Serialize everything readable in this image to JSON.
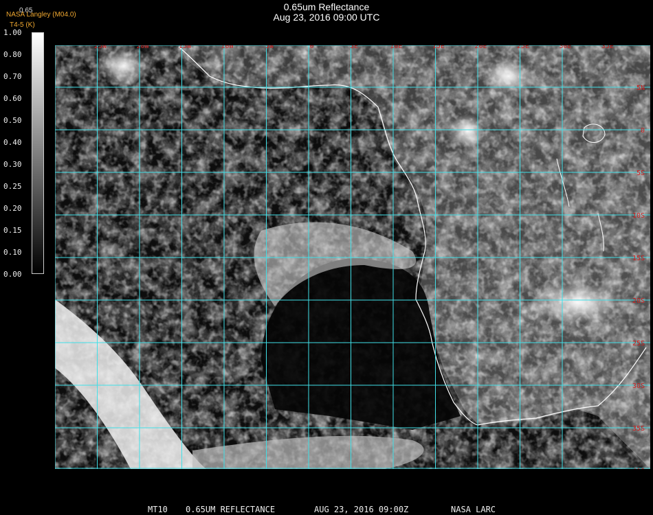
{
  "header": {
    "title": "0.65um Reflectance",
    "datetime": "Aug 23, 2016 09:00 UTC",
    "credit": "NASA Langley (M04.0)",
    "units": "T4-5 (K)",
    "top_value": "0.65"
  },
  "colorbar": {
    "labels": [
      "1.00",
      "0.80",
      "0.70",
      "0.60",
      "0.50",
      "0.40",
      "0.30",
      "0.25",
      "0.20",
      "0.15",
      "0.10",
      "0.00"
    ]
  },
  "map": {
    "lon_labels": [
      "25W",
      "20W",
      "15W",
      "10W",
      "5W",
      "0",
      "5E",
      "10E",
      "15E",
      "20E",
      "25E",
      "30E",
      "35E"
    ],
    "lat_labels": [
      "5N",
      "0",
      "5S",
      "10S",
      "15S",
      "20S",
      "25S",
      "30S",
      "35S",
      "40S"
    ],
    "grid_color": "#40e0e8",
    "label_color": "#d02020",
    "coast_color": "#ffffff"
  },
  "footer": {
    "satellite": "MT10",
    "product": "0.65UM REFLECTANCE",
    "datetime": "AUG 23, 2016 09:00Z",
    "source": "NASA LARC"
  }
}
